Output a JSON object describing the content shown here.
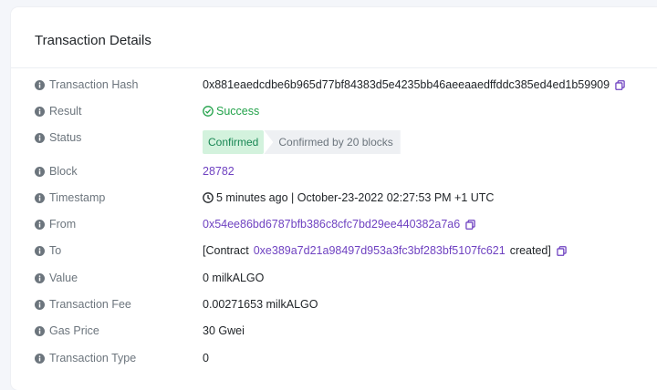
{
  "card": {
    "title": "Transaction Details"
  },
  "rows": {
    "hash": {
      "label": "Transaction Hash",
      "value": "0x881eaedcdbe6b965d77bf84383d5e4235bb46aeeaaedffddc385ed4ed1b59909"
    },
    "result": {
      "label": "Result",
      "value": "Success"
    },
    "status": {
      "label": "Status",
      "badge": "Confirmed",
      "confirmations": "Confirmed by 20 blocks"
    },
    "block": {
      "label": "Block",
      "value": "28782"
    },
    "timestamp": {
      "label": "Timestamp",
      "value": "5 minutes ago | October-23-2022 02:27:53 PM +1 UTC"
    },
    "from": {
      "label": "From",
      "value": "0x54ee86bd6787bfb386c8cfc7bd29ee440382a7a6"
    },
    "to": {
      "label": "To",
      "prefix": "[Contract",
      "address": "0xe389a7d21a98497d953a3fc3bf283bf5107fc621",
      "suffix": "created]"
    },
    "value": {
      "label": "Value",
      "value": "0 milkALGO"
    },
    "fee": {
      "label": "Transaction Fee",
      "value": "0.00271653 milkALGO"
    },
    "gas": {
      "label": "Gas Price",
      "value": "30 Gwei"
    },
    "type": {
      "label": "Transaction Type",
      "value": "0"
    }
  },
  "colors": {
    "link": "#6f42c1",
    "success": "#22a24a",
    "badge_bg": "#d3f2dd"
  },
  "icons": {
    "info": "info-circle-icon",
    "copy": "copy-icon",
    "check": "check-circle-icon",
    "clock": "clock-icon"
  }
}
